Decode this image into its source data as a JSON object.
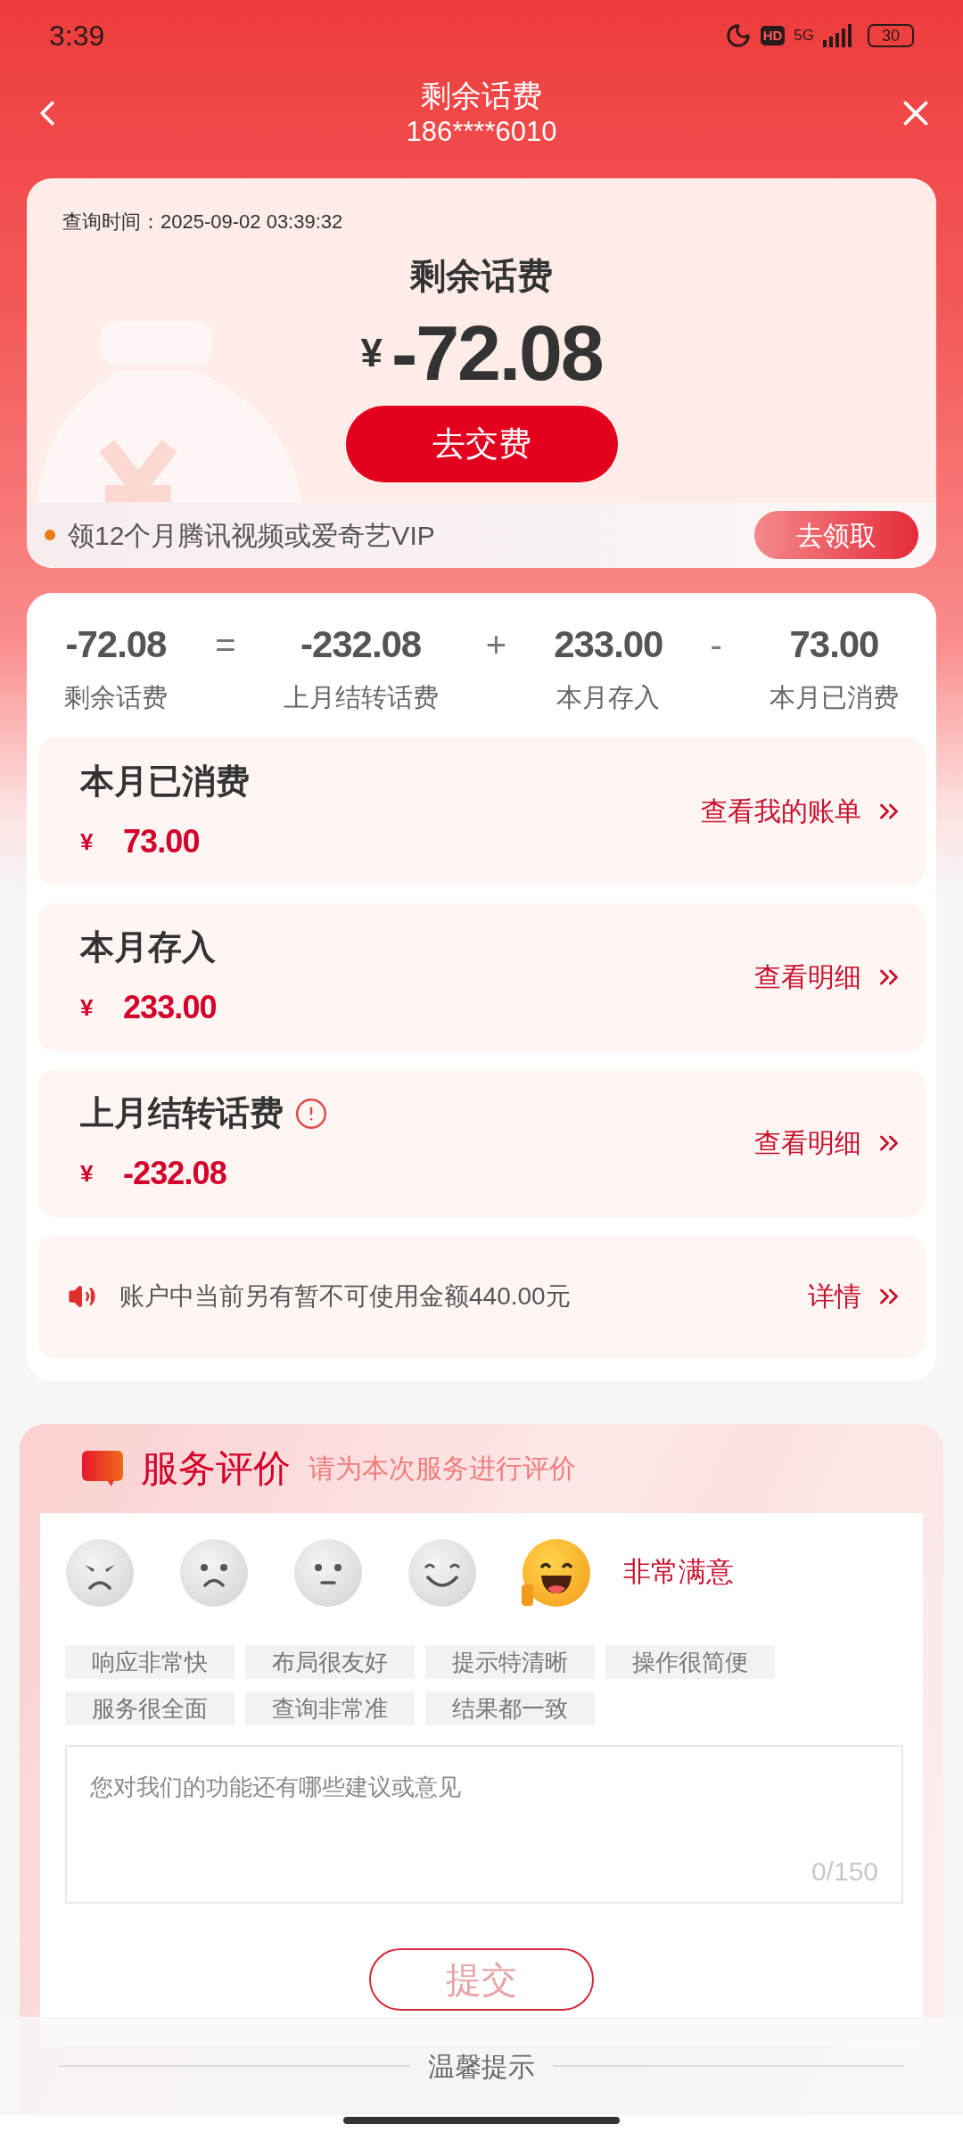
{
  "status_bar": {
    "time": "3:39",
    "hd": "HD",
    "network": "5G",
    "battery": "30"
  },
  "header": {
    "title": "剩余话费",
    "subtitle": "186****6010"
  },
  "balance_card": {
    "query_time": "查询时间：2025-09-02 03:39:32",
    "title": "剩余话费",
    "currency": "¥",
    "amount": "-72.08",
    "pay_button": "去交费",
    "promo": {
      "text": "领12个月腾讯视频或爱奇艺VIP",
      "button": "去领取"
    }
  },
  "equation": {
    "terms": [
      {
        "value": "-72.08",
        "label": "剩余话费"
      },
      {
        "value": "-232.08",
        "label": "上月结转话费"
      },
      {
        "value": "233.00",
        "label": "本月存入"
      },
      {
        "value": "73.00",
        "label": "本月已消费"
      }
    ],
    "operators": [
      "=",
      "+",
      "-"
    ]
  },
  "details": [
    {
      "title": "本月已消费",
      "currency": "¥",
      "amount": "73.00",
      "link": "查看我的账单",
      "warning": false
    },
    {
      "title": "本月存入",
      "currency": "¥",
      "amount": "233.00",
      "link": "查看明细",
      "warning": false
    },
    {
      "title": "上月结转话费",
      "currency": "¥",
      "amount": "-232.08",
      "link": "查看明细",
      "warning": true
    }
  ],
  "notice": {
    "text": "账户中当前另有暂不可使用金额440.00元",
    "link": "详情"
  },
  "rating": {
    "title": "服务评价",
    "subtitle": "请为本次服务进行评价",
    "faces": [
      {
        "kind": "angry",
        "selected": false
      },
      {
        "kind": "sad",
        "selected": false
      },
      {
        "kind": "neutral",
        "selected": false
      },
      {
        "kind": "smile",
        "selected": false
      },
      {
        "kind": "laugh",
        "selected": true
      }
    ],
    "selected_label": "非常满意",
    "tags": [
      {
        "label": "响应非常快",
        "selected": false
      },
      {
        "label": "布局很友好",
        "selected": false
      },
      {
        "label": "提示特清晰",
        "selected": false
      },
      {
        "label": "操作很简便",
        "selected": false
      },
      {
        "label": "服务很全面",
        "selected": false
      },
      {
        "label": "查询非常准",
        "selected": false
      },
      {
        "label": "结果都一致",
        "selected": false
      }
    ],
    "comment": {
      "placeholder": "您对我们的功能还有哪些建议或意见",
      "counter": "0/150"
    },
    "submit": "提交"
  },
  "footer": {
    "title": "温馨提示"
  }
}
